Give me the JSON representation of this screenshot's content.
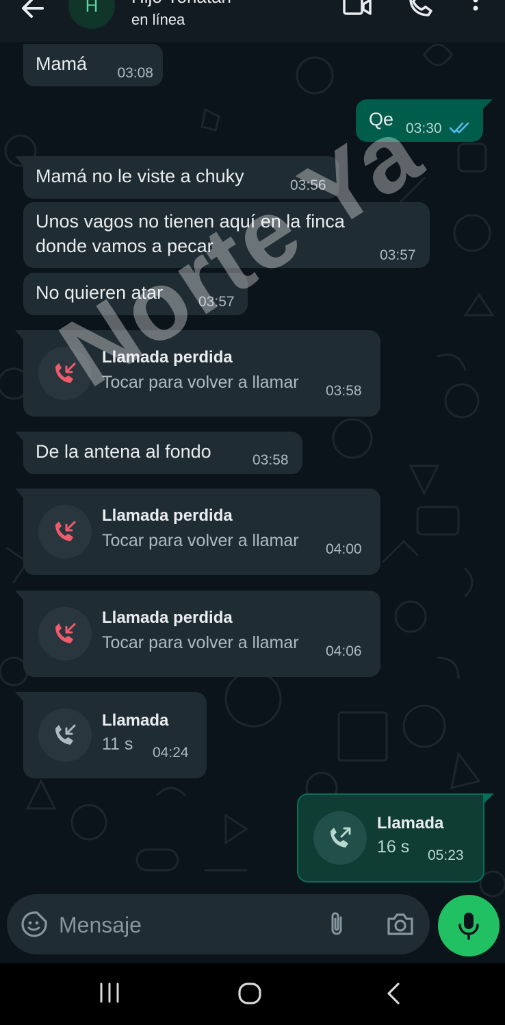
{
  "header": {
    "avatar_letter": "H",
    "contact_name": "Hijo Yonatan",
    "status": "en línea"
  },
  "messages": [
    {
      "type": "text",
      "dir": "in",
      "text": "Mamá",
      "time": "03:08"
    },
    {
      "type": "text",
      "dir": "out",
      "text": "Qe",
      "time": "03:30",
      "read": true
    },
    {
      "type": "text",
      "dir": "in",
      "text": "Mamá no le viste a chuky",
      "time": "03:56"
    },
    {
      "type": "text",
      "dir": "in",
      "lines": [
        "Unos vagos no tienen aquí en la finca",
        "donde vamos a pecar"
      ],
      "time": "03:57"
    },
    {
      "type": "text",
      "dir": "in",
      "text": "No quieren atar",
      "time": "03:57"
    },
    {
      "type": "call",
      "dir": "in",
      "title": "Llamada perdida",
      "subtitle": "Tocar para volver a llamar",
      "time": "03:58",
      "icon": "missed-call-icon"
    },
    {
      "type": "text",
      "dir": "in",
      "text": "De la antena al fondo",
      "time": "03:58"
    },
    {
      "type": "call",
      "dir": "in",
      "title": "Llamada perdida",
      "subtitle": "Tocar para volver a llamar",
      "time": "04:00",
      "icon": "missed-call-icon"
    },
    {
      "type": "call",
      "dir": "in",
      "title": "Llamada perdida",
      "subtitle": "Tocar para volver a llamar",
      "time": "04:06",
      "icon": "missed-call-icon"
    },
    {
      "type": "call",
      "dir": "in",
      "title": "Llamada",
      "subtitle": "11 s",
      "time": "04:24",
      "icon": "incoming-call-icon"
    },
    {
      "type": "call",
      "dir": "out",
      "title": "Llamada",
      "subtitle": "16 s",
      "time": "05:23",
      "icon": "outgoing-call-icon"
    }
  ],
  "watermark": "Norte Ya",
  "composer": {
    "placeholder": "Mensaje"
  },
  "colors": {
    "background": "#0b141a",
    "incoming_bubble": "#202c33",
    "outgoing_bubble": "#005c4b",
    "accent": "#21c063",
    "missed_call": "#f15c6d",
    "read_ticks": "#53bdeb"
  }
}
